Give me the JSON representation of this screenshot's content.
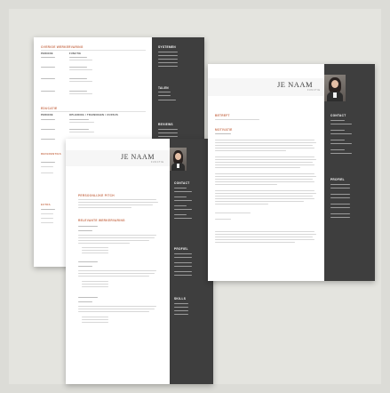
{
  "back_sheet": {
    "section_experience": "Overige werkervaring",
    "section_education": "Educatie",
    "section_education_sub": "Opleiding / Trainingen / Cursus",
    "section_references": "Referenties",
    "section_extra": "Extra",
    "sidebar_systems": "Systemen",
    "sidebar_languages": "Talen",
    "sidebar_reviews": "Reviews",
    "col_period": "Periode",
    "col_function": "Functie"
  },
  "middle_sheet": {
    "name": "JE NAAM",
    "subtitle": "FUNCTIE",
    "section_profile": "Persoonlijke pitch",
    "section_experience": "Relevante werkervaring",
    "sidebar_contact": "Contact",
    "sidebar_profile": "Profiel",
    "sidebar_skills": "Skills"
  },
  "front_sheet": {
    "name": "JE NAAM",
    "subtitle": "FUNCTIE",
    "section_subject": "Betreft",
    "section_motivation": "Motivatie",
    "sidebar_contact": "Contact",
    "sidebar_profile": "Profiel"
  },
  "colors": {
    "accent": "#c8704f",
    "sidebar": "#3e3e3e",
    "paper": "#ffffff",
    "background": "#dcdcd7"
  }
}
